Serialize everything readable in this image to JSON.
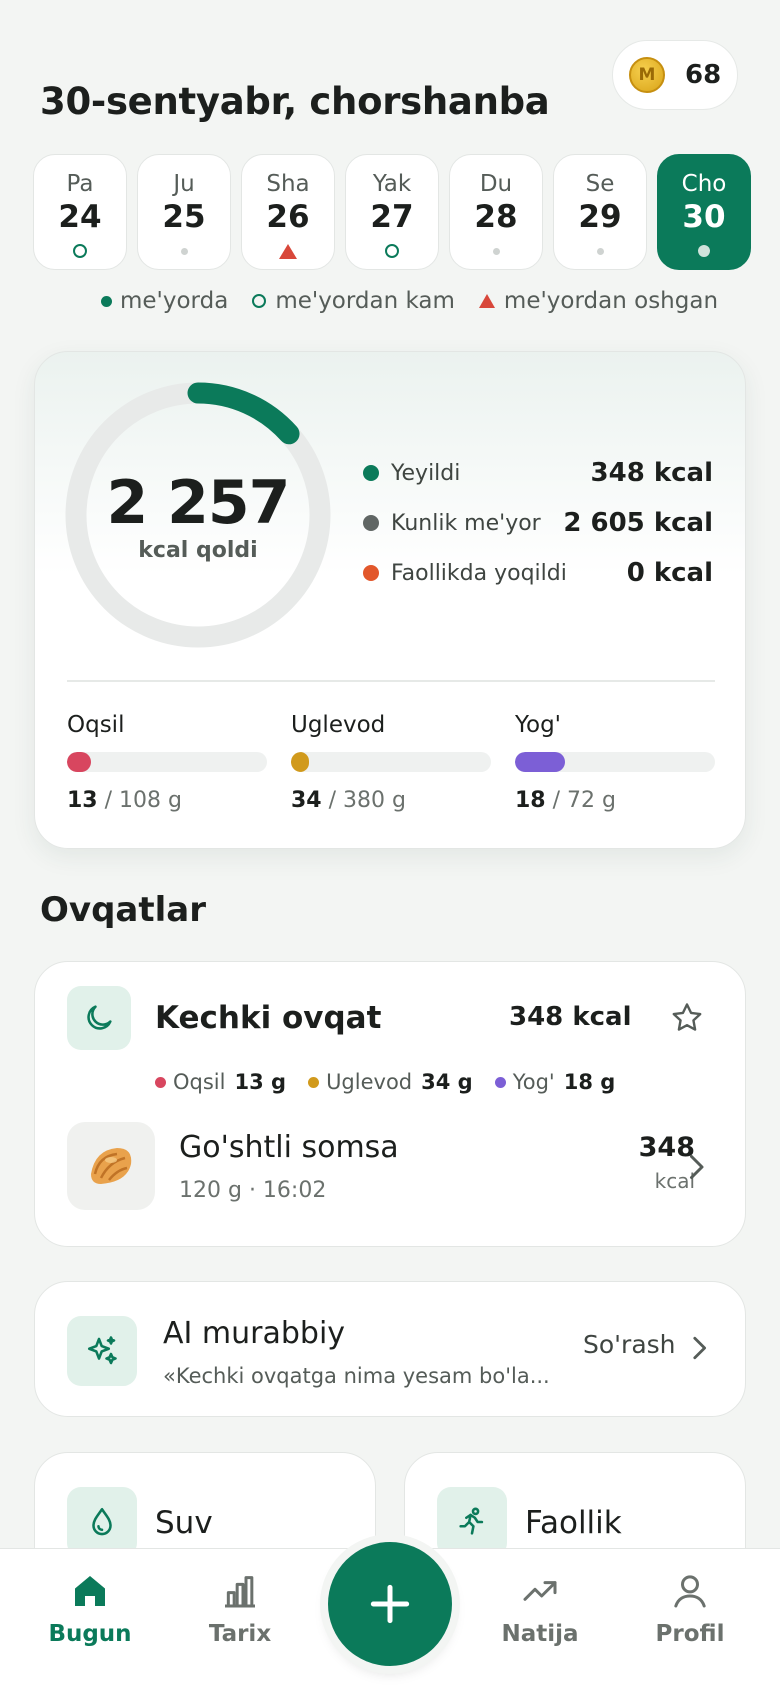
{
  "coins": {
    "count": "68",
    "symbol": "M"
  },
  "header": {
    "date_title": "30-sentyabr, chorshanba"
  },
  "days": [
    {
      "name": "Pa",
      "num": "24",
      "mark": "ring"
    },
    {
      "name": "Ju",
      "num": "25",
      "mark": "dot"
    },
    {
      "name": "Sha",
      "num": "26",
      "mark": "triangle"
    },
    {
      "name": "Yak",
      "num": "27",
      "mark": "ring"
    },
    {
      "name": "Du",
      "num": "28",
      "mark": "dot"
    },
    {
      "name": "Se",
      "num": "29",
      "mark": "dot"
    },
    {
      "name": "Cho",
      "num": "30",
      "mark": "dot",
      "active": true
    }
  ],
  "legend": {
    "normal": "me'yorda",
    "under": "me'yordan kam",
    "over": "me'yordan oshgan"
  },
  "summary": {
    "remaining": "2 257",
    "remaining_label": "kcal qoldi",
    "progress_fraction": 0.134,
    "stats": [
      {
        "label": "Yeyildi",
        "value": "348 kcal",
        "color": "#0b7a5a"
      },
      {
        "label": "Kunlik me'yor",
        "value": "2 605 kcal",
        "color": "#606664"
      },
      {
        "label": "Faollikda yoqildi",
        "value": "0 kcal",
        "color": "#e2572b"
      }
    ],
    "macros": [
      {
        "name": "Oqsil",
        "eaten": "13",
        "total": "/ 108 g",
        "fraction": 0.12,
        "color": "#d8465f"
      },
      {
        "name": "Uglevod",
        "eaten": "34",
        "total": "/ 380 g",
        "fraction": 0.09,
        "color": "#d19a1c"
      },
      {
        "name": "Yog'",
        "eaten": "18",
        "total": "/ 72 g",
        "fraction": 0.25,
        "color": "#7c5fd6"
      }
    ]
  },
  "meals_section": {
    "title": "Ovqatlar"
  },
  "meal": {
    "title": "Kechki ovqat",
    "kcal": "348 kcal",
    "macros": [
      {
        "label": "Oqsil",
        "value": "13 g",
        "color": "#d8465f"
      },
      {
        "label": "Uglevod",
        "value": "34 g",
        "color": "#d19a1c"
      },
      {
        "label": "Yog'",
        "value": "18 g",
        "color": "#7c5fd6"
      }
    ],
    "food": {
      "name": "Go'shtli somsa",
      "sub": "120 g · 16:02",
      "kcal": "348",
      "unit": "kcal"
    }
  },
  "ai": {
    "title": "AI murabbiy",
    "subtitle": "«Kechki ovqatga nima yesam bo'la...",
    "ask": "So'rash"
  },
  "widgets": {
    "water": "Suv",
    "activity": "Faollik"
  },
  "tabs": {
    "today": "Bugun",
    "history": "Tarix",
    "results": "Natija",
    "profile": "Profil"
  },
  "colors": {
    "accent": "#0b7a5a"
  }
}
